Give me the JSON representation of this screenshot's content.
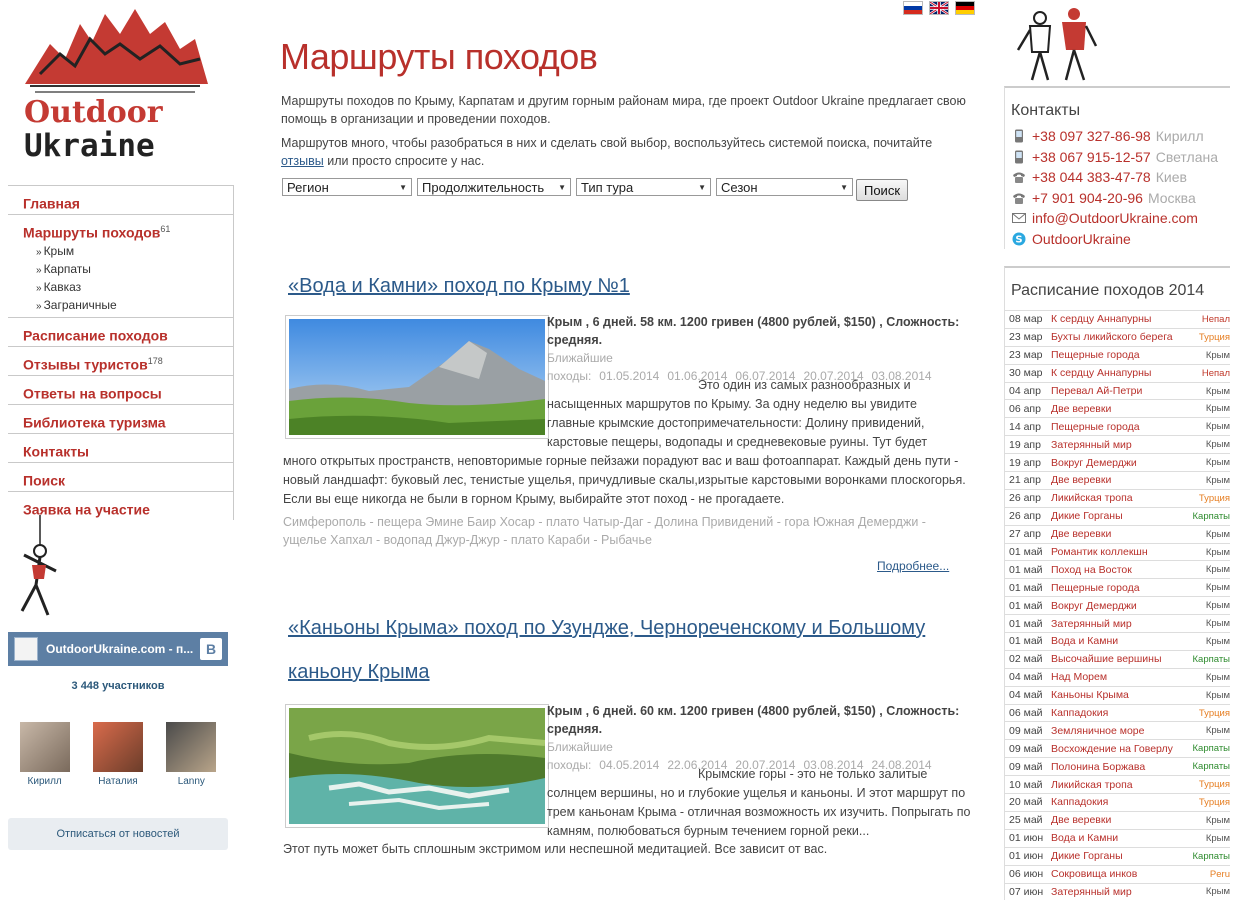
{
  "brand": {
    "logo_line1": "Outdoor",
    "logo_line2": "Ukraine"
  },
  "nav": {
    "items": [
      {
        "label": "Главная",
        "count": ""
      },
      {
        "label": "Маршруты походов",
        "count": "61"
      },
      {
        "label": "Расписание походов",
        "count": ""
      },
      {
        "label": "Отзывы туристов",
        "count": "178"
      },
      {
        "label": "Ответы на вопросы",
        "count": ""
      },
      {
        "label": "Библиотека туризма",
        "count": ""
      },
      {
        "label": "Контакты",
        "count": ""
      },
      {
        "label": "Поиск",
        "count": ""
      },
      {
        "label": "Заявка на участие",
        "count": ""
      }
    ],
    "subitems": [
      "Крым",
      "Карпаты",
      "Кавказ",
      "Заграничные"
    ]
  },
  "vk": {
    "group_name": "OutdoorUkraine.com - п...",
    "members": "3 448 участников",
    "faces": [
      "Кирилл",
      "Наталия",
      "Lanny"
    ],
    "unsubscribe": "Отписаться от новостей",
    "logo_letter": "В"
  },
  "page": {
    "title": "Маршруты походов",
    "intro1": "Маршруты походов по Крыму, Карпатам и другим горным районам мира, где проект Outdoor Ukraine предлагает свою помощь в организации и проведении походов.",
    "intro2_pre": "Маршрутов много, чтобы разобраться в них и сделать свой выбор, воспользуйтесь системой поиска, почитайте ",
    "intro2_link": "отзывы",
    "intro2_post": " или просто спросите у нас."
  },
  "filters": {
    "region": "Регион",
    "duration": "Продолжительность",
    "tour_type": "Тип тура",
    "season": "Сезон",
    "search_button": "Поиск"
  },
  "tours": [
    {
      "title": "«Вода и Камни» поход по Крыму №1",
      "meta": "Крым , 6 дней. 58 км. 1200 гривен (4800 рублей, $150) , Сложность: средняя.",
      "dates_label": "Ближайшие походы:",
      "dates": [
        "01.05.2014",
        "01.06.2014",
        "06.07.2014",
        "20.07.2014",
        "03.08.2014"
      ],
      "desc_side": "Это один из самых разнообразных и насыщенных маршрутов по Крыму. За одну неделю вы увидите главные крымские достопримечательности:  Долину привидений, карстовые пещеры, водопады и средневековые руины. Тут будет",
      "desc_full": "много открытых пространств, неповторимые горные пейзажи порадуют вас и ваш фотоаппарат. Каждый день пути - новый ландшафт: буковый лес, тенистые ущелья, причудливые скалы,изрытые карстовыми воронками плоскогорья.  Если вы еще никогда не были в горном Крыму, выбирайте этот поход - не прогадаете.",
      "route": "Симферополь - пещера Эмине Баир Хосар - плато Чатыр-Даг - Долина Привидений - гора Южная Демерджи - ущелье Хапхал - водопад Джур-Джур - плато Караби - Рыбачье",
      "more": "Подробнее..."
    },
    {
      "title": "«Каньоны Крыма» поход по Узундже, Чернореченскому и Большому каньону Крыма",
      "meta": "Крым , 6 дней. 60 км. 1200 гривен (4800 рублей, $150) , Сложность: средняя.",
      "dates_label": "Ближайшие походы:",
      "dates": [
        "04.05.2014",
        "22.06.2014",
        "20.07.2014",
        "03.08.2014",
        "24.08.2014"
      ],
      "desc_side": "Крымские горы - это не только залитые солнцем вершины, но и глубокие ущелья и каньоны. И этот маршрут по трем каньонам Крыма - отличная возможность их изучить. Попрыгать по камням, полюбоваться бурным течением горной реки...",
      "desc_full": "Этот путь может быть сплошным экстримом или неспешной медитацией. Все зависит от вас."
    }
  ],
  "contacts": {
    "title": "Контакты",
    "rows": [
      {
        "icon": "mobile-phone-icon",
        "value": "+38 097 327-86-98",
        "name": "Кирилл"
      },
      {
        "icon": "mobile-phone-icon",
        "value": "+38 067 915-12-57",
        "name": "Светлана"
      },
      {
        "icon": "landline-phone-icon",
        "value": "+38 044 383-47-78",
        "name": "Киев"
      },
      {
        "icon": "landline-phone-icon",
        "value": "+7 901 904-20-96",
        "name": "Москва"
      },
      {
        "icon": "email-icon",
        "value": "info@OutdoorUkraine.com",
        "name": ""
      },
      {
        "icon": "skype-icon",
        "value": "OutdoorUkraine",
        "name": ""
      }
    ]
  },
  "schedule": {
    "title": "Расписание походов 2014",
    "colors": {
      "Непал": "#c0392b",
      "Турция": "#e67e22",
      "Крым": "#555555",
      "Карпаты": "#2e8b2e",
      "Peru": "#e67e22"
    },
    "rows": [
      {
        "date": "08 мар",
        "name": "К сердцу Аннапурны",
        "region": "Непал"
      },
      {
        "date": "23 мар",
        "name": "Бухты ликийского берега",
        "region": "Турция"
      },
      {
        "date": "23 мар",
        "name": "Пещерные города",
        "region": "Крым"
      },
      {
        "date": "30 мар",
        "name": "К сердцу Аннапурны",
        "region": "Непал"
      },
      {
        "date": "04 апр",
        "name": "Перевал Ай-Петри",
        "region": "Крым"
      },
      {
        "date": "06 апр",
        "name": "Две веревки",
        "region": "Крым"
      },
      {
        "date": "14 апр",
        "name": "Пещерные города",
        "region": "Крым"
      },
      {
        "date": "19 апр",
        "name": "Затерянный мир",
        "region": "Крым"
      },
      {
        "date": "19 апр",
        "name": "Вокруг Демерджи",
        "region": "Крым"
      },
      {
        "date": "21 апр",
        "name": "Две веревки",
        "region": "Крым"
      },
      {
        "date": "26 апр",
        "name": "Ликийская тропа",
        "region": "Турция"
      },
      {
        "date": "26 апр",
        "name": "Дикие Горганы",
        "region": "Карпаты"
      },
      {
        "date": "27 апр",
        "name": "Две веревки",
        "region": "Крым"
      },
      {
        "date": "01 май",
        "name": "Романтик коллекшн",
        "region": "Крым"
      },
      {
        "date": "01 май",
        "name": "Поход на Восток",
        "region": "Крым"
      },
      {
        "date": "01 май",
        "name": "Пещерные города",
        "region": "Крым"
      },
      {
        "date": "01 май",
        "name": "Вокруг Демерджи",
        "region": "Крым"
      },
      {
        "date": "01 май",
        "name": "Затерянный мир",
        "region": "Крым"
      },
      {
        "date": "01 май",
        "name": "Вода и Камни",
        "region": "Крым"
      },
      {
        "date": "02 май",
        "name": "Высочайшие вершины",
        "region": "Карпаты"
      },
      {
        "date": "04 май",
        "name": "Над Морем",
        "region": "Крым"
      },
      {
        "date": "04 май",
        "name": "Каньоны Крыма",
        "region": "Крым"
      },
      {
        "date": "06 май",
        "name": "Каппадокия",
        "region": "Турция"
      },
      {
        "date": "09 май",
        "name": "Земляничное море",
        "region": "Крым"
      },
      {
        "date": "09 май",
        "name": "Восхождение на Говерлу",
        "region": "Карпаты"
      },
      {
        "date": "09 май",
        "name": "Полонина Боржава",
        "region": "Карпаты"
      },
      {
        "date": "10 май",
        "name": "Ликийская тропа",
        "region": "Турция"
      },
      {
        "date": "20 май",
        "name": "Каппадокия",
        "region": "Турция"
      },
      {
        "date": "25 май",
        "name": "Две веревки",
        "region": "Крым"
      },
      {
        "date": "01 июн",
        "name": "Вода и Камни",
        "region": "Крым"
      },
      {
        "date": "01 июн",
        "name": "Дикие Горганы",
        "region": "Карпаты"
      },
      {
        "date": "06 июн",
        "name": "Сокровища инков",
        "region": "Peru"
      },
      {
        "date": "07 июн",
        "name": "Затерянный мир",
        "region": "Крым"
      }
    ]
  }
}
